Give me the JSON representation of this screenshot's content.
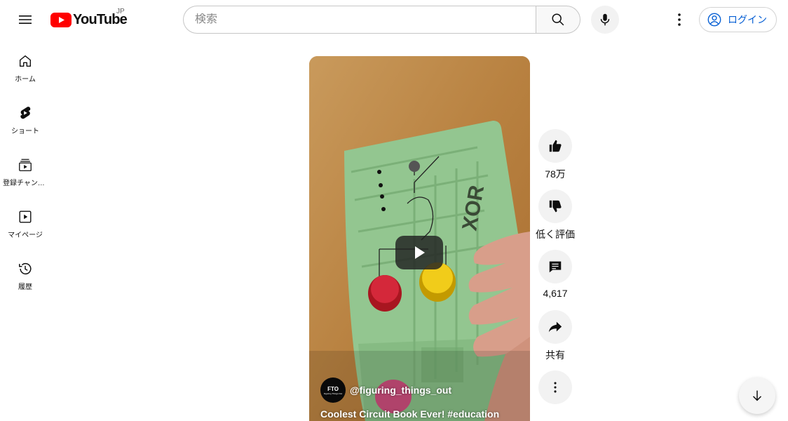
{
  "header": {
    "logo_text": "YouTube",
    "region": "JP",
    "search_placeholder": "検索",
    "login_label": "ログイン"
  },
  "sidebar": {
    "items": [
      {
        "label": "ホーム",
        "icon": "home-icon"
      },
      {
        "label": "ショート",
        "icon": "shorts-icon"
      },
      {
        "label": "登録チャンネル",
        "icon": "subscriptions-icon"
      },
      {
        "label": "マイページ",
        "icon": "you-icon"
      },
      {
        "label": "履歴",
        "icon": "history-icon"
      }
    ]
  },
  "video": {
    "channel_handle": "@figuring_things_out",
    "channel_avatar_text": "FTO",
    "channel_avatar_subtext": "Figuring Things Out",
    "title": "Coolest Circuit Book Ever! #education",
    "book_text": "XOR"
  },
  "actions": {
    "like_count": "78万",
    "dislike_label": "低く評価",
    "comment_count": "4,617",
    "share_label": "共有"
  },
  "colors": {
    "brand_red": "#ff0000",
    "link_blue": "#065fd4",
    "board_green": "#8fc48c"
  }
}
